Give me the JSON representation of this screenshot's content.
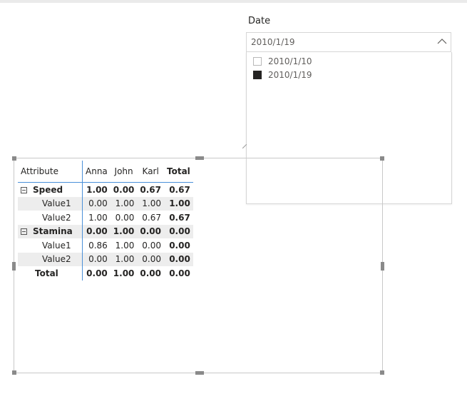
{
  "slicer": {
    "title": "Date",
    "selected": "2010/1/19",
    "options": [
      {
        "label": "2010/1/10",
        "checked": false
      },
      {
        "label": "2010/1/19",
        "checked": true
      }
    ]
  },
  "matrix": {
    "headers": [
      "Attribute",
      "Anna",
      "John",
      "Karl",
      "Total"
    ],
    "rows": [
      {
        "label": "Speed",
        "values": [
          "1.00",
          "0.00",
          "0.67",
          "0.67"
        ]
      },
      {
        "label": "Value1",
        "values": [
          "0.00",
          "1.00",
          "1.00",
          "1.00"
        ]
      },
      {
        "label": "Value2",
        "values": [
          "1.00",
          "0.00",
          "0.67",
          "0.67"
        ]
      },
      {
        "label": "Stamina",
        "values": [
          "0.00",
          "1.00",
          "0.00",
          "0.00"
        ]
      },
      {
        "label": "Value1",
        "values": [
          "0.86",
          "1.00",
          "0.00",
          "0.00"
        ]
      },
      {
        "label": "Value2",
        "values": [
          "0.00",
          "1.00",
          "0.00",
          "0.00"
        ]
      },
      {
        "label": "Total",
        "values": [
          "0.00",
          "1.00",
          "0.00",
          "0.00"
        ]
      }
    ]
  }
}
